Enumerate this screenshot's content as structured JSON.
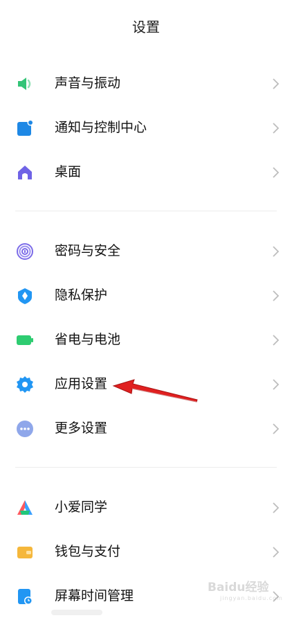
{
  "header": {
    "title": "设置"
  },
  "settings": {
    "items": [
      {
        "label": "声音与振动",
        "icon": "speaker-icon",
        "color": "#33c477"
      },
      {
        "label": "通知与控制中心",
        "icon": "notification-icon",
        "color": "#1e88e5"
      },
      {
        "label": "桌面",
        "icon": "home-icon",
        "color": "#6f63e6"
      },
      {
        "label": "密码与安全",
        "icon": "fingerprint-icon",
        "color": "#7b6be8"
      },
      {
        "label": "隐私保护",
        "icon": "shield-icon",
        "color": "#2196f3"
      },
      {
        "label": "省电与电池",
        "icon": "battery-icon",
        "color": "#2ecc71"
      },
      {
        "label": "应用设置",
        "icon": "gear-icon",
        "color": "#2196f3"
      },
      {
        "label": "更多设置",
        "icon": "more-dots-icon",
        "color": "#7f9be6"
      },
      {
        "label": "小爱同学",
        "icon": "xiaoai-icon",
        "color": "#ff5a5f"
      },
      {
        "label": "钱包与支付",
        "icon": "wallet-icon",
        "color": "#f5b73b"
      },
      {
        "label": "屏幕时间管理",
        "icon": "screen-time-icon",
        "color": "#2196f3"
      }
    ]
  },
  "annotation": {
    "arrow_color": "#e02020",
    "points_to": "应用设置"
  },
  "watermark": {
    "logo_text": "Baidu经验",
    "sub_text": "jingyan.baidu.com"
  }
}
